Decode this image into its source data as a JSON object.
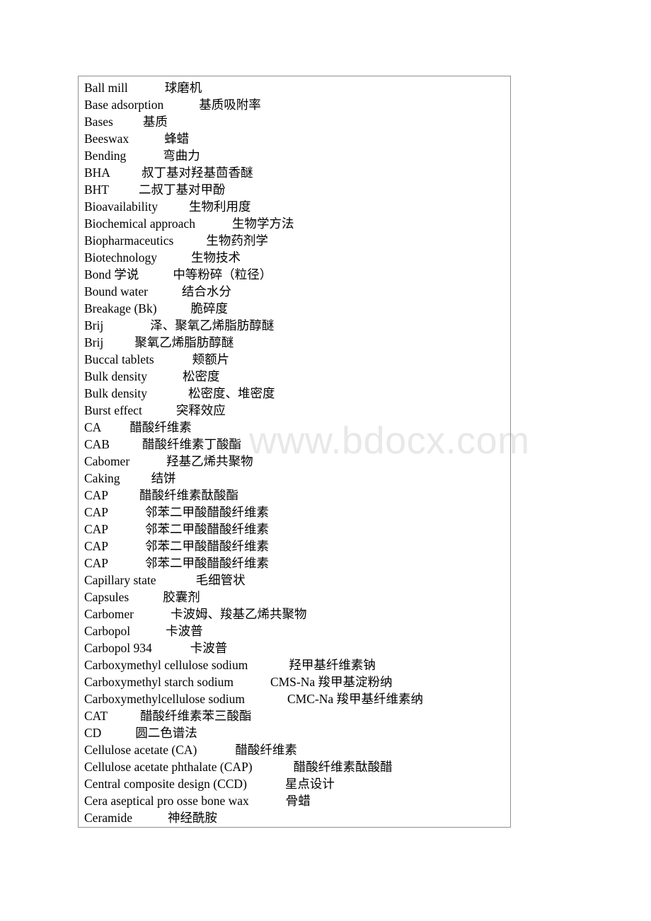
{
  "page": {
    "background_color": "#ffffff",
    "text_color": "#000000",
    "border_color": "#8f8f8f"
  },
  "watermark": {
    "text": "www.bdocx.com",
    "color": "#e8e8e8"
  },
  "glossary": {
    "name": "english-chinese-pharmaceutics-glossary",
    "entries": [
      {
        "term": "Ball mill",
        "gap": 52,
        "definition": "球磨机"
      },
      {
        "term": "Base adsorption",
        "gap": 50,
        "definition": "基质吸附率"
      },
      {
        "term": "Bases",
        "gap": 42,
        "definition": "基质"
      },
      {
        "term": "Beeswax",
        "gap": 50,
        "definition": "蜂蜡"
      },
      {
        "term": "Bending",
        "gap": 52,
        "definition": "弯曲力"
      },
      {
        "term": "BHA",
        "gap": 44,
        "definition": "叔丁基对羟基茴香醚"
      },
      {
        "term": "BHT",
        "gap": 42,
        "definition": "二叔丁基对甲酚"
      },
      {
        "term": "Bioavailability",
        "gap": 44,
        "definition": "生物利用度"
      },
      {
        "term": "Biochemical approach",
        "gap": 52,
        "definition": "生物学方法"
      },
      {
        "term": "Biopharmaceutics",
        "gap": 46,
        "definition": "生物药剂学"
      },
      {
        "term": "Biotechnology",
        "gap": 48,
        "definition": "生物技术"
      },
      {
        "term": "Bond 学说",
        "gap": 48,
        "definition": "中等粉碎（粒径）"
      },
      {
        "term": "Bound water",
        "gap": 48,
        "definition": "结合水分"
      },
      {
        "term": "Breakage (Bk)",
        "gap": 48,
        "definition": "脆碎度"
      },
      {
        "term": "Brij",
        "gap": 66,
        "definition": "泽、聚氧乙烯脂肪醇醚"
      },
      {
        "term": "Brij",
        "gap": 44,
        "definition": "聚氧乙烯脂肪醇醚"
      },
      {
        "term": "Buccal tablets",
        "gap": 54,
        "definition": "颊额片"
      },
      {
        "term": "Bulk density",
        "gap": 50,
        "definition": "松密度"
      },
      {
        "term": "Bulk density",
        "gap": 58,
        "definition": "松密度、堆密度"
      },
      {
        "term": "Burst effect",
        "gap": 48,
        "definition": "突释效应"
      },
      {
        "term": "CA",
        "gap": 40,
        "definition": "醋酸纤维素"
      },
      {
        "term": "CAB",
        "gap": 46,
        "definition": "醋酸纤维素丁酸酯"
      },
      {
        "term": "Cabomer",
        "gap": 52,
        "definition": "羟基乙烯共聚物"
      },
      {
        "term": "Caking",
        "gap": 44,
        "definition": "结饼"
      },
      {
        "term": "CAP",
        "gap": 44,
        "definition": "醋酸纤维素酞酸酯"
      },
      {
        "term": "CAP",
        "gap": 52,
        "definition": "邻苯二甲酸醋酸纤维素"
      },
      {
        "term": "CAP",
        "gap": 52,
        "definition": "邻苯二甲酸醋酸纤维素"
      },
      {
        "term": "CAP",
        "gap": 52,
        "definition": "邻苯二甲酸醋酸纤维素"
      },
      {
        "term": "CAP",
        "gap": 52,
        "definition": "邻苯二甲酸醋酸纤维素"
      },
      {
        "term": "Capillary state",
        "gap": 56,
        "definition": "毛细管状"
      },
      {
        "term": "Capsules",
        "gap": 48,
        "definition": "胶囊剂"
      },
      {
        "term": "Carbomer",
        "gap": 52,
        "definition": "卡波姆、羧基乙烯共聚物"
      },
      {
        "term": "Carbopol",
        "gap": 50,
        "definition": "卡波普"
      },
      {
        "term": "Carbopol 934",
        "gap": 54,
        "definition": "卡波普"
      },
      {
        "term": "Carboxymethyl cellulose sodium",
        "gap": 58,
        "definition": "羟甲基纤维素钠"
      },
      {
        "term": "Carboxymethyl starch sodium",
        "gap": 52,
        "definition": "CMS-Na 羧甲基淀粉纳"
      },
      {
        "term": "Carboxymethylcellulose sodium",
        "gap": 60,
        "definition": "CMC-Na 羧甲基纤维素纳"
      },
      {
        "term": "CAT",
        "gap": 46,
        "definition": "醋酸纤维素苯三酸酯"
      },
      {
        "term": "CD",
        "gap": 48,
        "definition": "圆二色谱法"
      },
      {
        "term": "Cellulose acetate (CA)",
        "gap": 54,
        "definition": "醋酸纤维素"
      },
      {
        "term": "Cellulose acetate phthalate (CAP)",
        "gap": 58,
        "definition": "醋酸纤维素酞酸醋"
      },
      {
        "term": "Central composite design (CCD)",
        "gap": 54,
        "definition": "星点设计"
      },
      {
        "term": "Cera aseptical pro osse bone wax",
        "gap": 52,
        "definition": "骨蜡"
      },
      {
        "term": "Ceramide",
        "gap": 50,
        "definition": "神经酰胺"
      }
    ]
  }
}
